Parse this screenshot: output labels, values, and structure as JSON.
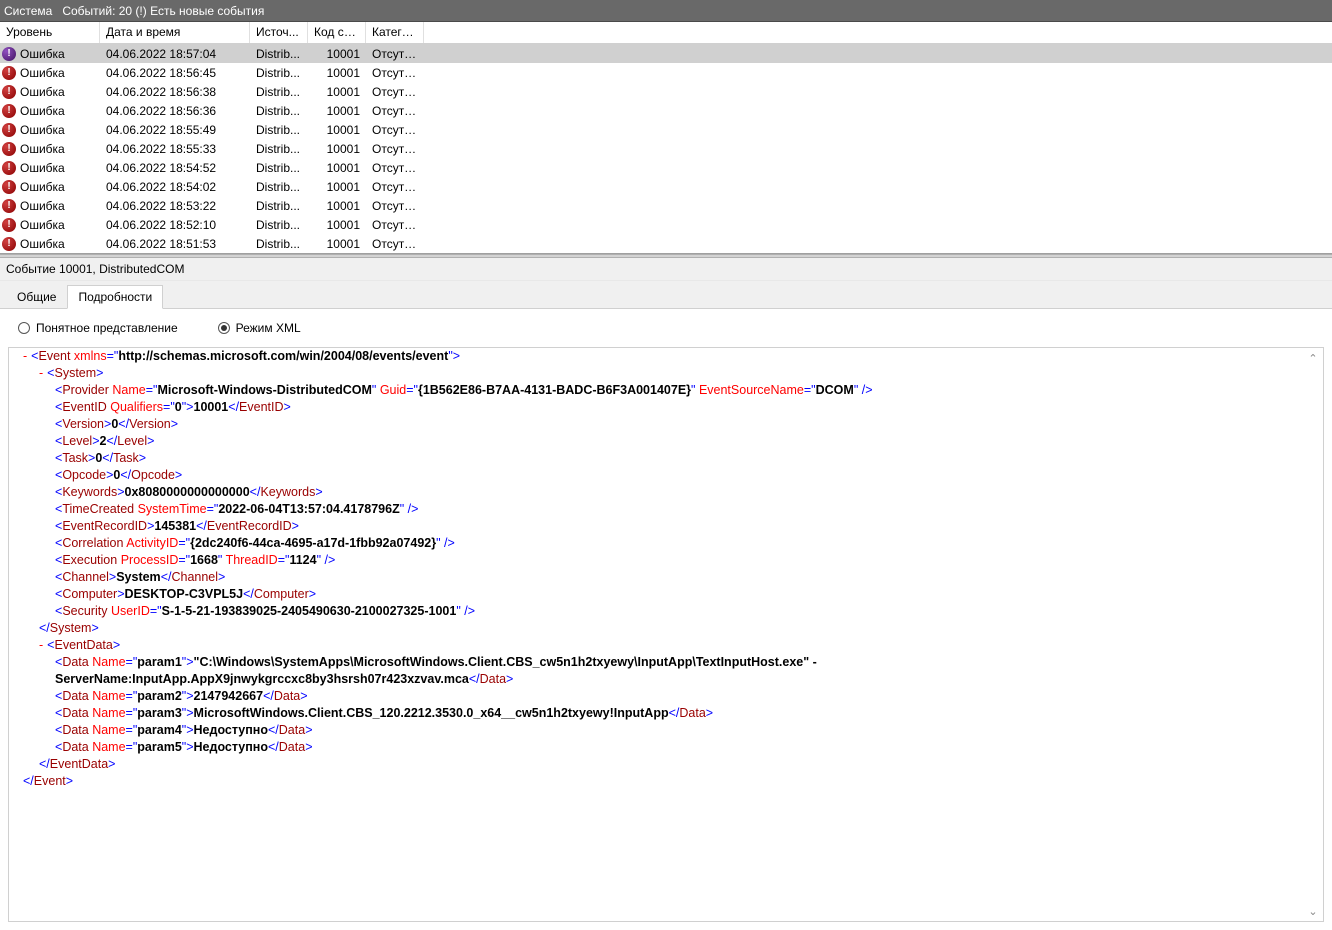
{
  "topbar": {
    "title": "Система",
    "status": "Событий: 20 (!) Есть новые события"
  },
  "columns": {
    "level": "Уровень",
    "date": "Дата и время",
    "source": "Источ...",
    "code": "Код со...",
    "category": "Катего..."
  },
  "rows": [
    {
      "level": "Ошибка",
      "date": "04.06.2022 18:57:04",
      "source": "Distrib...",
      "code": "10001",
      "category": "Отсутс...",
      "selected": true
    },
    {
      "level": "Ошибка",
      "date": "04.06.2022 18:56:45",
      "source": "Distrib...",
      "code": "10001",
      "category": "Отсутс..."
    },
    {
      "level": "Ошибка",
      "date": "04.06.2022 18:56:38",
      "source": "Distrib...",
      "code": "10001",
      "category": "Отсутс..."
    },
    {
      "level": "Ошибка",
      "date": "04.06.2022 18:56:36",
      "source": "Distrib...",
      "code": "10001",
      "category": "Отсутс..."
    },
    {
      "level": "Ошибка",
      "date": "04.06.2022 18:55:49",
      "source": "Distrib...",
      "code": "10001",
      "category": "Отсутс..."
    },
    {
      "level": "Ошибка",
      "date": "04.06.2022 18:55:33",
      "source": "Distrib...",
      "code": "10001",
      "category": "Отсутс..."
    },
    {
      "level": "Ошибка",
      "date": "04.06.2022 18:54:52",
      "source": "Distrib...",
      "code": "10001",
      "category": "Отсутс..."
    },
    {
      "level": "Ошибка",
      "date": "04.06.2022 18:54:02",
      "source": "Distrib...",
      "code": "10001",
      "category": "Отсутс..."
    },
    {
      "level": "Ошибка",
      "date": "04.06.2022 18:53:22",
      "source": "Distrib...",
      "code": "10001",
      "category": "Отсутс..."
    },
    {
      "level": "Ошибка",
      "date": "04.06.2022 18:52:10",
      "source": "Distrib...",
      "code": "10001",
      "category": "Отсутс..."
    },
    {
      "level": "Ошибка",
      "date": "04.06.2022 18:51:53",
      "source": "Distrib...",
      "code": "10001",
      "category": "Отсутс..."
    }
  ],
  "detail": {
    "title": "Событие 10001, DistributedCOM",
    "tabs": {
      "general": "Общие",
      "details": "Подробности"
    },
    "radios": {
      "friendly": "Понятное представление",
      "xml": "Режим XML"
    }
  },
  "xml": {
    "xmlns": "http://schemas.microsoft.com/win/2004/08/events/event",
    "provider_name": "Microsoft-Windows-DistributedCOM",
    "provider_guid": "{1B562E86-B7AA-4131-BADC-B6F3A001407E}",
    "provider_src": "DCOM",
    "eventid_qualifiers": "0",
    "eventid": "10001",
    "version": "0",
    "level": "2",
    "task": "0",
    "opcode": "0",
    "keywords": "0x8080000000000000",
    "time": "2022-06-04T13:57:04.4178796Z",
    "recordid": "145381",
    "activityid": "{2dc240f6-44ca-4695-a17d-1fbb92a07492}",
    "processid": "1668",
    "threadid": "1124",
    "channel": "System",
    "computer": "DESKTOP-C3VPL5J",
    "userid": "S-1-5-21-193839025-2405490630-2100027325-1001",
    "param1": "\"C:\\Windows\\SystemApps\\MicrosoftWindows.Client.CBS_cw5n1h2txyewy\\InputApp\\TextInputHost.exe\" -ServerName:InputApp.AppX9jnwykgrccxc8by3hsrsh07r423xzvav.mca",
    "param2": "2147942667",
    "param3": "MicrosoftWindows.Client.CBS_120.2212.3530.0_x64__cw5n1h2txyewy!InputApp",
    "param4": "Недоступно",
    "param5": "Недоступно"
  }
}
